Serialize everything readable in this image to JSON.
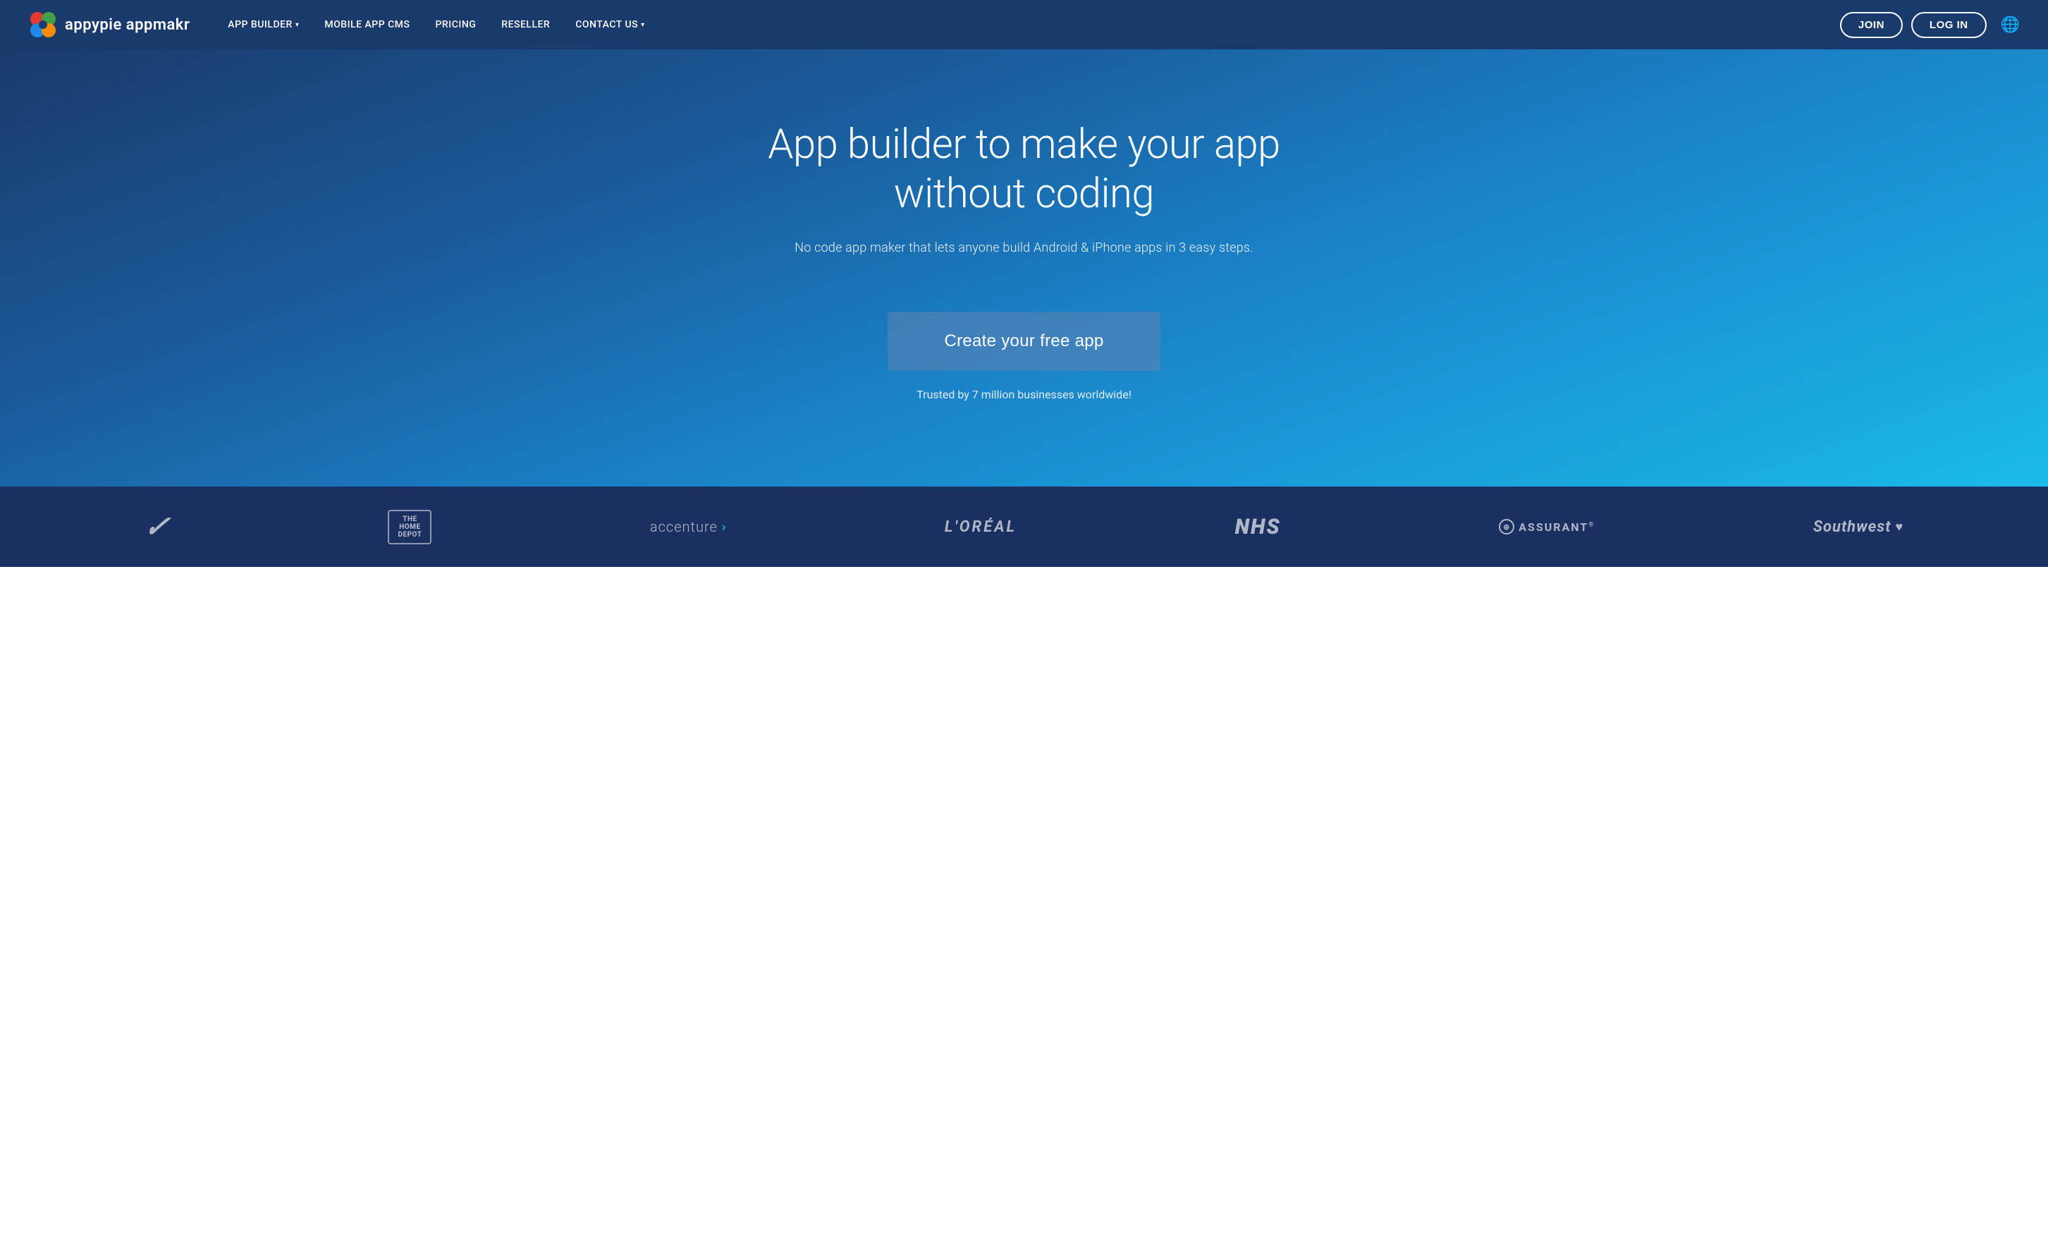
{
  "brand": {
    "name": "appypie appmakr",
    "logo_aria": "Appy Pie Appmakr Logo"
  },
  "navbar": {
    "links": [
      {
        "label": "APP BUILDER",
        "has_dropdown": true
      },
      {
        "label": "MOBILE APP CMS",
        "has_dropdown": false
      },
      {
        "label": "PRICING",
        "has_dropdown": false
      },
      {
        "label": "RESELLER",
        "has_dropdown": false
      },
      {
        "label": "CONTACT US",
        "has_dropdown": true
      }
    ],
    "join_label": "JOIN",
    "login_label": "LOG IN"
  },
  "hero": {
    "title": "App builder to make your app without coding",
    "subtitle": "No code app maker that lets anyone build Android & iPhone apps in 3 easy steps.",
    "cta_label": "Create your free app",
    "trust_text": "Trusted by 7 million businesses worldwide!"
  },
  "brands": [
    {
      "name": "Nike",
      "display": "✔"
    },
    {
      "name": "The Home Depot",
      "display": "THE HOME DEPOT"
    },
    {
      "name": "Accenture",
      "display": "accenture >"
    },
    {
      "name": "L'Oreal",
      "display": "L'ORÉAL"
    },
    {
      "name": "NHS",
      "display": "NHS"
    },
    {
      "name": "Assurant",
      "display": "⊕ ASSURANT®"
    },
    {
      "name": "Southwest",
      "display": "Southwest♥"
    }
  ]
}
